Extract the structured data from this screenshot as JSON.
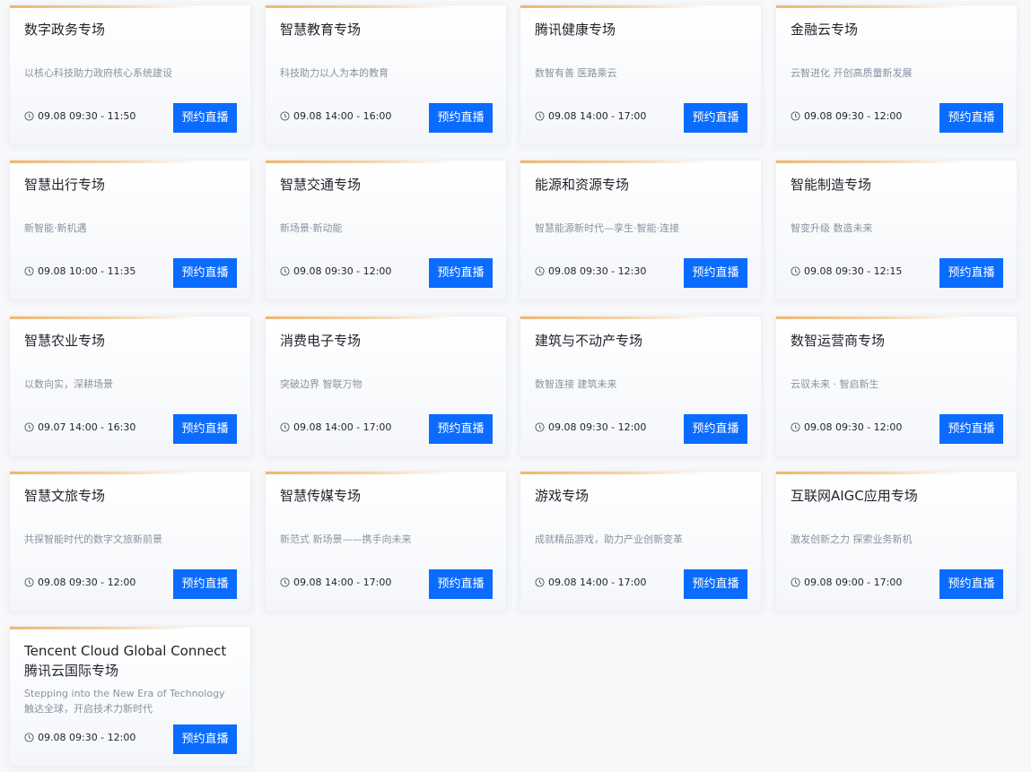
{
  "button_label": "预约直播",
  "icons": {
    "clock": "clock-icon"
  },
  "colors": {
    "accent": "#0a6cff",
    "top_bar": "#f2b66e",
    "muted_text": "#8a919f"
  },
  "sessions": [
    {
      "title": "数字政务专场",
      "desc": "以核心科技助力政府核心系统建设",
      "time": "09.08 09:30 - 11:50"
    },
    {
      "title": "智慧教育专场",
      "desc": "科技助力以人为本的教育",
      "time": "09.08 14:00 - 16:00"
    },
    {
      "title": "腾讯健康专场",
      "desc": "数智有善 医路乘云",
      "time": "09.08 14:00 - 17:00"
    },
    {
      "title": "金融云专场",
      "desc": "云智进化 开创高质量新发展",
      "time": "09.08 09:30 - 12:00"
    },
    {
      "title": "智慧出行专场",
      "desc": "新智能·新机遇",
      "time": "09.08 10:00 - 11:35"
    },
    {
      "title": "智慧交通专场",
      "desc": "新场景·新动能",
      "time": "09.08 09:30 - 12:00"
    },
    {
      "title": "能源和资源专场",
      "desc": "智慧能源新时代—孪生·智能·连接",
      "time": "09.08 09:30 - 12:30"
    },
    {
      "title": "智能制造专场",
      "desc": "智变升级 数造未来",
      "time": "09.08 09:30 - 12:15"
    },
    {
      "title": "智慧农业专场",
      "desc": "以数向实，深耕场景",
      "time": "09.07 14:00 - 16:30"
    },
    {
      "title": "消费电子专场",
      "desc": "突破边界 智联万物",
      "time": "09.08 14:00 - 17:00"
    },
    {
      "title": "建筑与不动产专场",
      "desc": "数智连接 建筑未来",
      "time": "09.08 09:30 - 12:00"
    },
    {
      "title": "数智运营商专场",
      "desc": "云驭未来 · 智启新生",
      "time": "09.08 09:30 - 12:00"
    },
    {
      "title": "智慧文旅专场",
      "desc": "共探智能时代的数字文旅新前景",
      "time": "09.08 09:30 - 12:00"
    },
    {
      "title": "智慧传媒专场",
      "desc": "新范式 新场景——携手向未来",
      "time": "09.08 14:00 - 17:00"
    },
    {
      "title": "游戏专场",
      "desc": "成就精品游戏，助力产业创新变革",
      "time": "09.08 14:00 - 17:00"
    },
    {
      "title": "互联网AIGC应用专场",
      "desc": "激发创新之力 探索业务新机",
      "time": "09.08 09:00 - 17:00"
    },
    {
      "title": "Tencent Cloud Global Connect 腾讯云国际专场",
      "desc": "Stepping into the New Era of Technology 触达全球，开启技术力新时代",
      "time": "09.08 09:30 - 12:00"
    }
  ]
}
